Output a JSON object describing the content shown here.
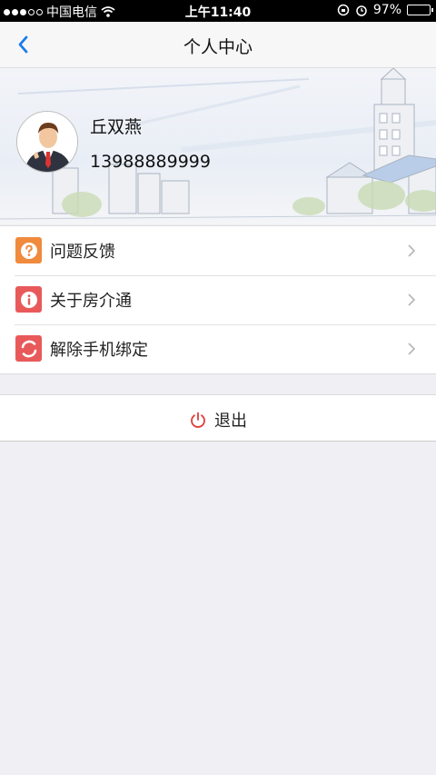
{
  "status_bar": {
    "carrier": "中国电信",
    "time": "上午11:40",
    "battery_percent": "97%",
    "battery_level": 0.97
  },
  "nav": {
    "title": "个人中心",
    "back_icon": "chevron-left-icon"
  },
  "profile": {
    "name": "丘双燕",
    "phone": "13988889999",
    "avatar_icon": "businessman-avatar-icon"
  },
  "menu": [
    {
      "label": "问题反馈",
      "icon": "question-icon",
      "color": "#f08a3c"
    },
    {
      "label": "关于房介通",
      "icon": "info-icon",
      "color": "#e85a5a"
    },
    {
      "label": "解除手机绑定",
      "icon": "unbind-icon",
      "color": "#e85a5a"
    }
  ],
  "logout": {
    "label": "退出",
    "icon": "power-icon",
    "icon_color": "#e03c3c"
  },
  "colors": {
    "accent": "#1a7ce8",
    "background": "#efeff4"
  }
}
